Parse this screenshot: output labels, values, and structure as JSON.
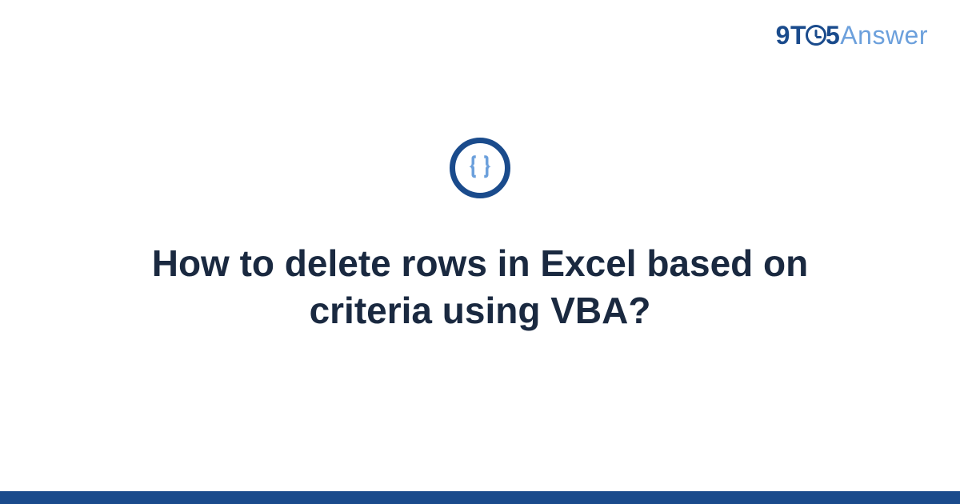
{
  "logo": {
    "part1": "9T",
    "part2": "5",
    "part3": "Answer"
  },
  "icon": {
    "name": "code-braces-icon",
    "glyph": "{ }"
  },
  "title": "How to delete rows in Excel based on criteria using VBA?",
  "colors": {
    "primary": "#1a4b8c",
    "accent": "#6ca0dc",
    "text": "#1a2940"
  }
}
